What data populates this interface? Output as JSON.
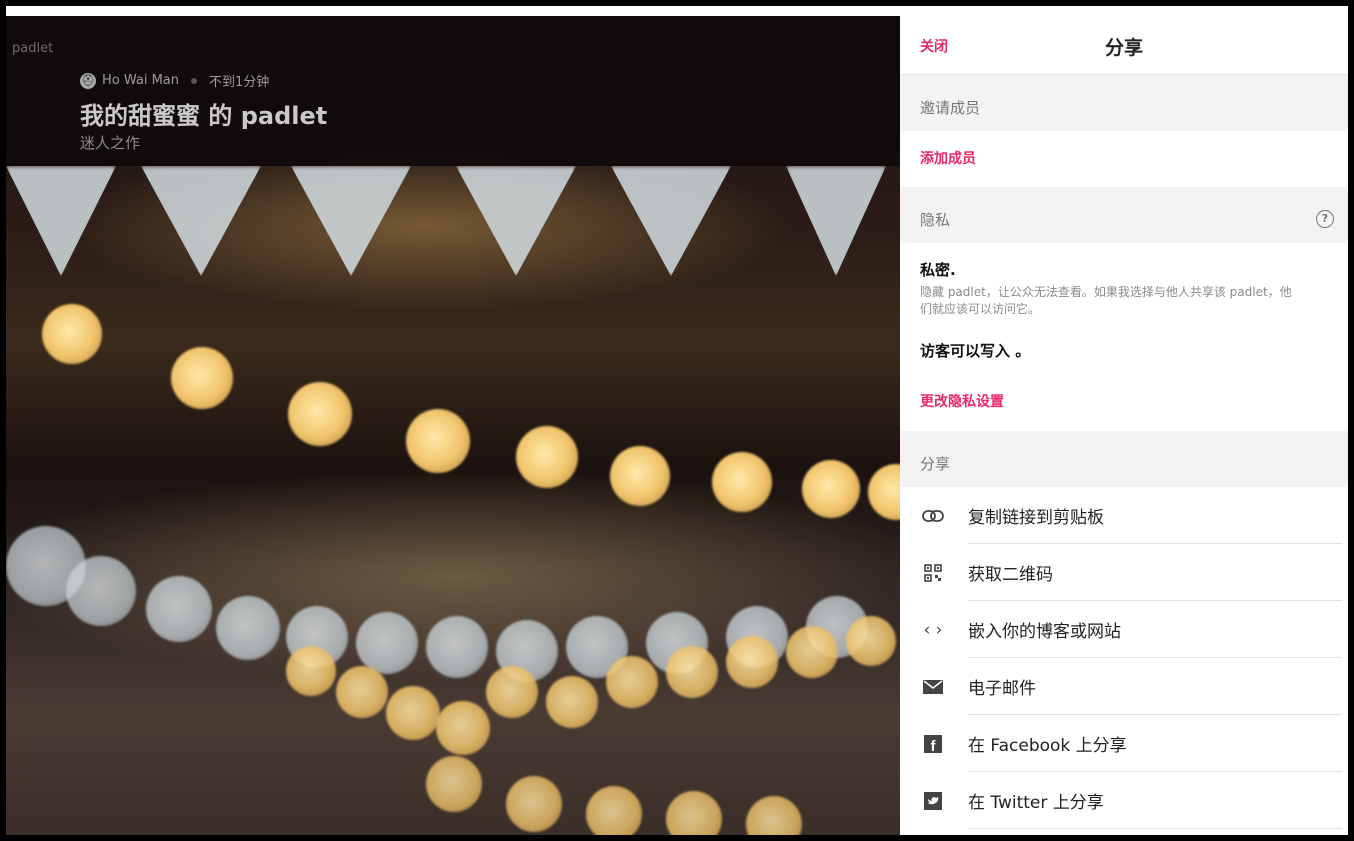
{
  "app": {
    "brand": "padlet"
  },
  "padlet": {
    "author": "Ho Wai Man",
    "time": "不到1分钟",
    "title": "我的甜蜜蜜 的 padlet",
    "subtitle": "迷人之作"
  },
  "share_panel": {
    "close_label": "关闭",
    "title": "分享",
    "invite": {
      "header": "邀请成员",
      "add_label": "添加成员"
    },
    "privacy": {
      "header": "隐私",
      "help_icon": "?",
      "title": "私密.",
      "description": "隐藏 padlet，让公众无法查看。如果我选择与他人共享该 padlet，他们就应该可以访问它。",
      "guest": "访客可以写入 。",
      "change_label": "更改隐私设置"
    },
    "share": {
      "header": "分享",
      "items": [
        {
          "label": "复制链接到剪贴板",
          "icon": "link-icon"
        },
        {
          "label": "获取二维码",
          "icon": "qr-code-icon"
        },
        {
          "label": "嵌入你的博客或网站",
          "icon": "code-icon"
        },
        {
          "label": "电子邮件",
          "icon": "email-icon"
        },
        {
          "label": "在 Facebook 上分享",
          "icon": "facebook-icon"
        },
        {
          "label": "在 Twitter 上分享",
          "icon": "twitter-icon"
        }
      ]
    }
  },
  "colors": {
    "accent": "#e8296b"
  }
}
